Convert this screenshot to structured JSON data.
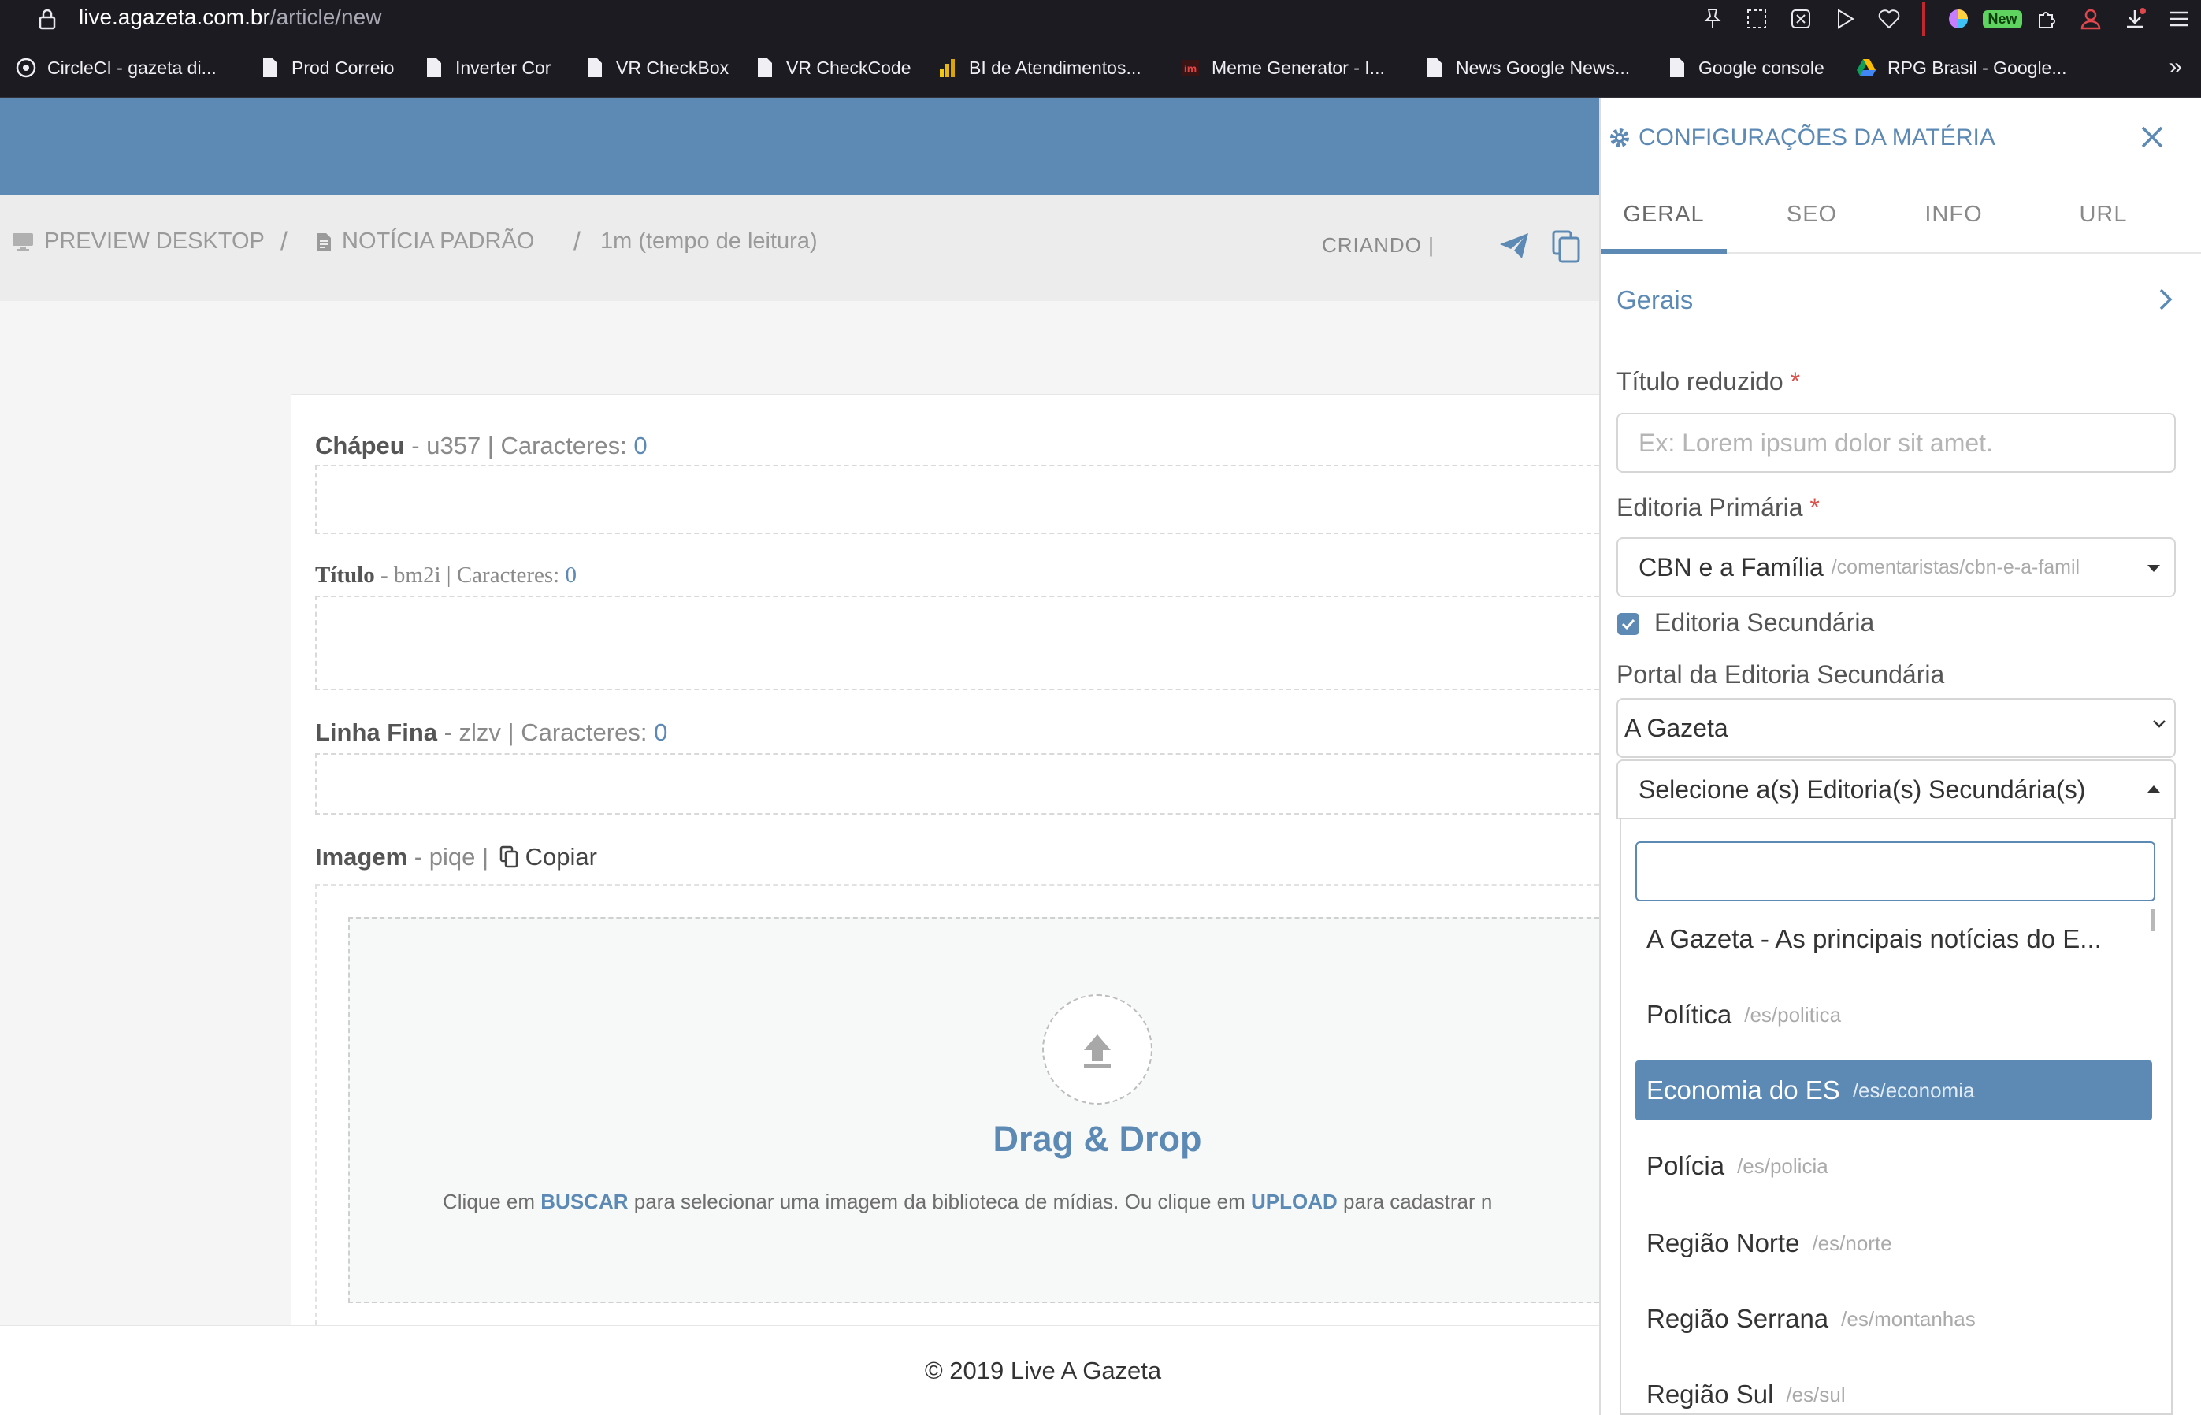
{
  "browser": {
    "url_host": "live.agazeta.com.br",
    "url_path": "/article/new",
    "new_badge": "New",
    "bookmarks": [
      {
        "label": "CircleCI - gazeta di...",
        "icon": "circleci-icon"
      },
      {
        "label": "Prod Correio",
        "icon": "page-icon"
      },
      {
        "label": "Inverter Cor",
        "icon": "page-icon"
      },
      {
        "label": "VR CheckBox",
        "icon": "page-icon"
      },
      {
        "label": "VR CheckCode",
        "icon": "page-icon"
      },
      {
        "label": "BI de Atendimentos...",
        "icon": "powerbi-icon"
      },
      {
        "label": "Meme Generator - I...",
        "icon": "imgflip-icon"
      },
      {
        "label": "News Google News...",
        "icon": "page-icon"
      },
      {
        "label": "Google console",
        "icon": "page-icon"
      },
      {
        "label": "RPG Brasil - Google...",
        "icon": "gdrive-icon"
      }
    ]
  },
  "breadcrumb": {
    "preview": "PREVIEW DESKTOP",
    "sep": "/",
    "type": "NOTÍCIA PADRÃO",
    "reading_time": "1m (tempo de leitura)"
  },
  "status": "CRIANDO |",
  "editor": {
    "chapeu": {
      "label": "Chápeu",
      "id": " - u357  |  Caracteres: ",
      "count": "0"
    },
    "titulo": {
      "label": "Título",
      "id": " - bm2i | Caracteres: ",
      "count": "0"
    },
    "linha_fina": {
      "label": "Linha Fina",
      "id": " - zlzv  |  Caracteres: ",
      "count": "0"
    },
    "imagem": {
      "label": "Imagem",
      "id": " - piqe | ",
      "copy": "Copiar"
    },
    "drag_title": "Drag & Drop",
    "help_1": "Clique em ",
    "help_buscar": "BUSCAR",
    "help_2": " para selecionar uma imagem da biblioteca de mídias. Ou clique em ",
    "help_upload": "UPLOAD",
    "help_3": " para cadastrar n"
  },
  "footer": "© 2019 Live A Gazeta",
  "panel": {
    "title": "CONFIGURAÇÕES DA MATÉRIA",
    "tabs": [
      "GERAL",
      "SEO",
      "INFO",
      "URL"
    ],
    "active_tab": "GERAL",
    "section": "Gerais",
    "titulo_reduzido_label": "Título reduzido",
    "required_mark": "*",
    "titulo_reduzido_placeholder": "Ex: Lorem ipsum dolor sit amet.",
    "editoria_primaria_label": "Editoria Primária",
    "editoria_primaria_value": "CBN e a Família",
    "editoria_primaria_path": "/comentaristas/cbn-e-a-famil",
    "editoria_secundaria_label": "Editoria Secundária",
    "editoria_secundaria_checked": true,
    "portal_label": "Portal da Editoria Secundária",
    "portal_value": "A Gazeta",
    "secundarias_placeholder": "Selecione a(s) Editoria(s) Secundária(s)",
    "options": [
      {
        "label": "A Gazeta - As principais notícias do E...",
        "path": ""
      },
      {
        "label": "Política",
        "path": "/es/politica"
      },
      {
        "label": "Economia do ES",
        "path": "/es/economia"
      },
      {
        "label": "Polícia",
        "path": "/es/policia"
      },
      {
        "label": "Região Norte",
        "path": "/es/norte"
      },
      {
        "label": "Região Serrana",
        "path": "/es/montanhas"
      },
      {
        "label": "Região Sul",
        "path": "/es/sul"
      }
    ],
    "highlighted_option": "Economia do ES"
  },
  "colors": {
    "accent": "#5c8ab5",
    "browser_bg": "#1c1b22",
    "required": "#d9534f"
  }
}
